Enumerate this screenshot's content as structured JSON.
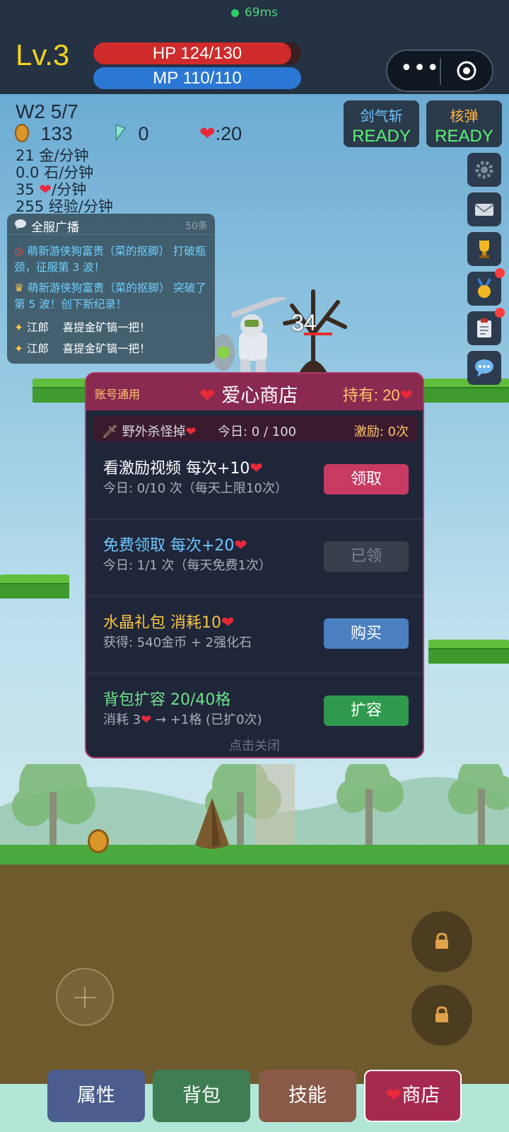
{
  "status": {
    "ping": "69ms"
  },
  "player": {
    "level": "Lv.3",
    "hp_text": "HP 124/130",
    "hp_fraction": 0.954,
    "mp_text": "MP 110/110",
    "mp_fraction": 1.0
  },
  "stats": {
    "wave": "W2 5/7",
    "gold": "133",
    "gems": "0",
    "hearts": ":20",
    "rates": [
      "21 金/分钟",
      "0.0 石/分钟",
      "/分钟",
      "255 经验/分钟"
    ],
    "heart_rate_value": "35"
  },
  "skills": [
    {
      "name": "剑气斩",
      "state": "READY"
    },
    {
      "name": "核弹",
      "state": "READY"
    }
  ],
  "side_buttons": [
    {
      "icon": "gear-icon"
    },
    {
      "icon": "mail-icon"
    },
    {
      "icon": "trophy-icon"
    },
    {
      "icon": "medal-icon",
      "badge": true
    },
    {
      "icon": "clipboard-icon",
      "badge": true
    },
    {
      "icon": "chat-icon"
    }
  ],
  "broadcast": {
    "title": "全服广播",
    "count": "50条",
    "messages": [
      {
        "icon": "target-icon",
        "text": "萌新游侠狗富贵（菜的抠脚） 打破瓶颈，征服第 3 波！"
      },
      {
        "icon": "trophy-icon",
        "text": "萌新游侠狗富贵（菜的抠脚） 突破了第 5 波！创下新纪录！"
      },
      {
        "icon": "sparkle-icon",
        "name": "江郎",
        "text": "喜提金矿镐一把！"
      },
      {
        "icon": "sparkle-icon",
        "name": "江郎",
        "text": "喜提金矿镐一把！"
      }
    ]
  },
  "battle": {
    "damage_number": "34"
  },
  "shop": {
    "account_tag": "账号通用",
    "title": "爱心商店",
    "holding": "持有: 20",
    "subbar": {
      "drop": "野外杀怪掉",
      "today": "今日: 0 / 100",
      "incentive": "激励: 0次"
    },
    "items": [
      {
        "title": "看激励视频  每次+10",
        "desc": "今日: 0/10 次（每天上限10次）",
        "button": "领取",
        "title_color": "#ffffff",
        "button_color": "#c73a62"
      },
      {
        "title": "免费领取  每次+20",
        "desc": "今日: 1/1 次（每天免费1次）",
        "button": "已领",
        "title_color": "#6fc8ff",
        "button_color": "#3a3f4e"
      },
      {
        "title": "水晶礼包  消耗10",
        "desc": "获得: 540金币 + 2强化石",
        "button": "购买",
        "title_color": "#f5c542",
        "button_color": "#4a7fc0"
      },
      {
        "title": "背包扩容  20/40格",
        "desc_pre": "消耗 3",
        "desc_post": " → +1格 (已扩0次)",
        "button": "扩容",
        "title_color": "#6ee28a",
        "button_color": "#2f9a4d"
      }
    ],
    "close_hint": "点击关闭"
  },
  "tabs": {
    "attributes": "属性",
    "bag": "背包",
    "skills": "技能",
    "shop": "商店"
  },
  "colors": {
    "accent_gold": "#f5d21e",
    "heart": "#e8293a",
    "ready": "#5ef27a"
  }
}
